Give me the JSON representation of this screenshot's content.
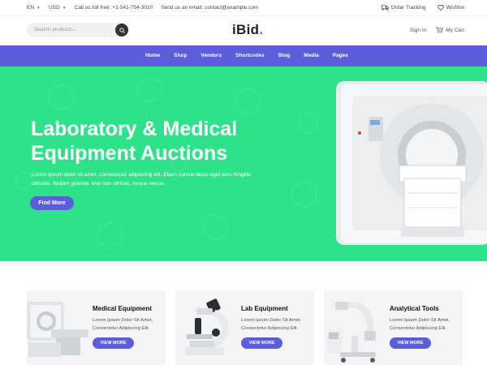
{
  "topbar": {
    "language": "EN",
    "currency": "USD",
    "call_text": "Call us toll free: +1-541-754-3010",
    "email_text": "Send us an email: contact@example.com",
    "order_tracking": "Order Tracking",
    "wishlist": "Wishlist"
  },
  "header": {
    "search_placeholder": "Search products...",
    "logo_text": "iBid",
    "logo_dot": ".",
    "sign_in": "Sign In",
    "cart": "My Cart"
  },
  "nav": {
    "items": [
      "Home",
      "Shop",
      "Vendors",
      "Shortcodes",
      "Blog",
      "Media",
      "Pages"
    ]
  },
  "hero": {
    "title_line1": "Laboratory & Medical",
    "title_line2": "Equipment Auctions",
    "text": "Lorem ipsum dolor sit amet, consectetur adipiscing elit. Etiam cursus lacus eget arcu fringilla ultricies. Nullam gravida, erat non ultrices, neque neque.",
    "button": "Find More"
  },
  "cards": [
    {
      "title": "Medical Equipment",
      "desc": "Lorem Ipsum Dolor Sit Amet, Consectetur Adipiscing Elit.",
      "button": "VIEW MORE"
    },
    {
      "title": "Lab Equipment",
      "desc": "Lorem Ipsum Dolor Sit Amet, Consectetur Adipiscing Elit.",
      "button": "VIEW MORE"
    },
    {
      "title": "Analytical Tools",
      "desc": "Lorem Ipsum Dolor Sit Amet, Consectetur Adipiscing Elit.",
      "button": "VIEW MORE"
    }
  ],
  "colors": {
    "accent": "#5b5ddb",
    "hero_bg": "#2de288"
  },
  "icons": [
    "chevron-down-icon",
    "search-icon",
    "truck-icon",
    "heart-icon",
    "cart-icon"
  ]
}
